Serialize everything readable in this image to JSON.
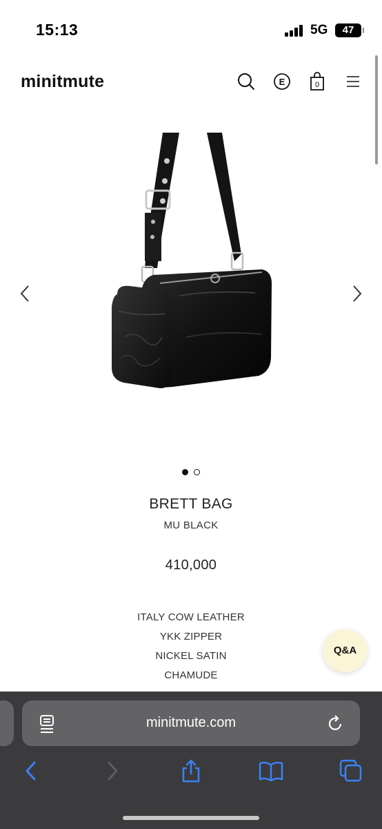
{
  "status_bar": {
    "time": "15:13",
    "network": "5G",
    "battery": "47"
  },
  "header": {
    "logo": "minitmute",
    "language_label": "E",
    "cart_count": "0",
    "icons": [
      "search-icon",
      "language-icon",
      "cart-icon",
      "menu-icon"
    ]
  },
  "carousel": {
    "image_subject": "black leather barrel shoulder bag",
    "prev_icon": "chevron-left-icon",
    "next_icon": "chevron-right-icon",
    "slide_count": 2,
    "active_slide": 1
  },
  "product": {
    "name": "BRETT BAG",
    "color": "MU BLACK",
    "price": "410,000",
    "specs": [
      "ITALY COW LEATHER",
      "YKK ZIPPER",
      "NICKEL SATIN",
      "CHAMUDE"
    ]
  },
  "qa_button": {
    "label": "Q&A"
  },
  "browser": {
    "url": "minitmute.com",
    "accent": "#3a82f7",
    "toolbar_icons": [
      "back-icon",
      "forward-icon",
      "share-icon",
      "bookmarks-icon",
      "tabs-icon"
    ]
  }
}
